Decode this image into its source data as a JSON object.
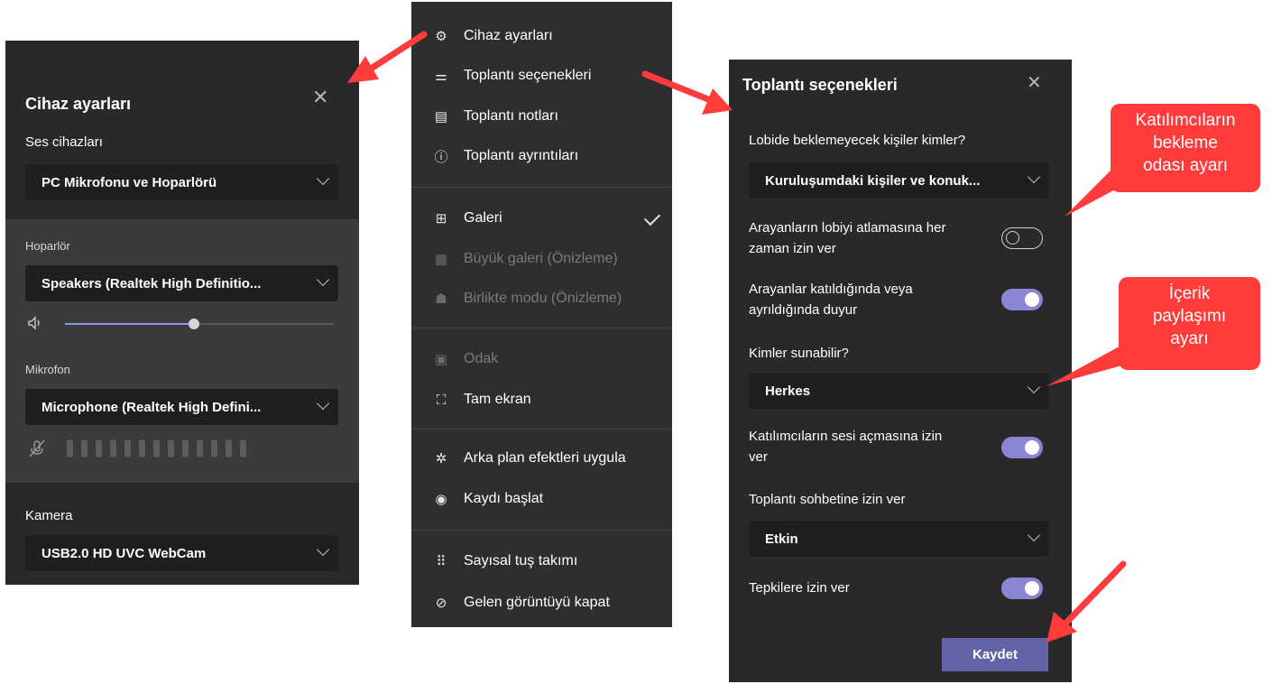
{
  "device_settings": {
    "title": "Cihaz ayarları",
    "audio_devices_label": "Ses cihazları",
    "audio_device_value": "PC Mikrofonu ve Hoparlörü",
    "speaker_label": "Hoparlör",
    "speaker_value": "Speakers (Realtek High Definitio...",
    "speaker_volume": 0.48,
    "microphone_label": "Mikrofon",
    "microphone_value": "Microphone (Realtek High Defini...",
    "camera_label": "Kamera",
    "camera_value": "USB2.0 HD UVC WebCam"
  },
  "menu": {
    "items": [
      {
        "label": "Cihaz ayarları",
        "icon": "gear-icon"
      },
      {
        "label": "Toplantı seçenekleri",
        "icon": "sliders-icon"
      },
      {
        "label": "Toplantı notları",
        "icon": "notes-icon"
      },
      {
        "label": "Toplantı ayrıntıları",
        "icon": "info-icon"
      },
      {
        "label": "Galeri",
        "icon": "gallery-icon",
        "checked": true
      },
      {
        "label": "Büyük galeri (Önizleme)",
        "icon": "large-gallery-icon",
        "disabled": true
      },
      {
        "label": "Birlikte modu (Önizleme)",
        "icon": "together-mode-icon",
        "disabled": true
      },
      {
        "label": "Odak",
        "icon": "focus-icon",
        "disabled": true
      },
      {
        "label": "Tam ekran",
        "icon": "fullscreen-icon"
      },
      {
        "label": "Arka plan efektleri uygula",
        "icon": "background-effects-icon"
      },
      {
        "label": "Kaydı başlat",
        "icon": "record-icon"
      },
      {
        "label": "Sayısal tuş takımı",
        "icon": "dialpad-icon"
      },
      {
        "label": "Gelen görüntüyü kapat",
        "icon": "video-off-icon"
      }
    ]
  },
  "meeting_options": {
    "title": "Toplantı seçenekleri",
    "lobby_question": "Lobide beklemeyecek kişiler kimler?",
    "lobby_value": "Kuruluşumdaki kişiler ve konuk...",
    "bypass_label_1": "Arayanların lobiyi atlamasına her",
    "bypass_label_2": "zaman izin ver",
    "bypass_on": false,
    "announce_label_1": "Arayanlar katıldığında veya",
    "announce_label_2": "ayrıldığında duyur",
    "announce_on": true,
    "presenters_label": "Kimler sunabilir?",
    "presenters_value": "Herkes",
    "unmute_label_1": "Katılımcıların sesi açmasına izin",
    "unmute_label_2": "ver",
    "unmute_on": true,
    "chat_label": "Toplantı sohbetine izin ver",
    "chat_value": "Etkin",
    "reactions_label": "Tepkilere izin ver",
    "reactions_on": true,
    "save_label": "Kaydet"
  },
  "callouts": {
    "waiting_room": [
      "Katılımcıların",
      "bekleme",
      "odası ayarı"
    ],
    "content_sharing": [
      "İçerik",
      "paylaşımı",
      "ayarı"
    ]
  },
  "colors": {
    "panel_bg": "#292929",
    "accent": "#6264a7",
    "toggle_on": "#8b86d4",
    "callout": "#ff3b3b"
  }
}
